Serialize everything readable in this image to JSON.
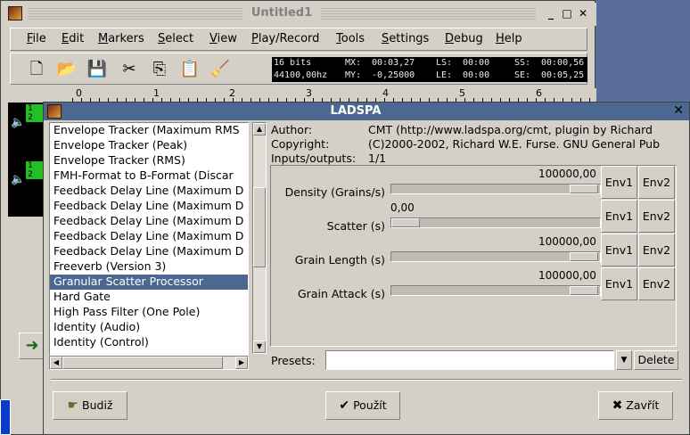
{
  "main_window": {
    "title": "Untitled1",
    "menu": [
      "File",
      "Edit",
      "Markers",
      "Select",
      "View",
      "Play/Record",
      "Tools",
      "Settings",
      "Debug",
      "Help"
    ],
    "toolbar_icons": [
      "new-file-icon",
      "open-folder-icon",
      "save-icon",
      "cut-icon",
      "copy-icon",
      "paste-icon",
      "clear-icon"
    ],
    "status": {
      "format": "16 bits",
      "rate": "44100,00hz",
      "mx_label": "MX:",
      "mx": "00:03,27",
      "my_label": "MY:",
      "my": "-0,25000",
      "ls_label": "LS:",
      "ls": "00:00",
      "le_label": "LE:",
      "le": "00:00",
      "ss_label": "SS:",
      "ss": "00:00,56",
      "se_label": "SE:",
      "se": "00:05,25"
    },
    "ruler_labels": [
      "0",
      "1",
      "2",
      "3",
      "4",
      "5",
      "6"
    ],
    "track_numbers": [
      "1",
      "2",
      "1",
      "2"
    ]
  },
  "dialog": {
    "title": "LADSPA",
    "plugins": [
      "Envelope Tracker (Maximum RMS",
      "Envelope Tracker (Peak)",
      "Envelope Tracker (RMS)",
      "FMH-Format to B-Format (Discar",
      "Feedback Delay Line (Maximum D",
      "Feedback Delay Line (Maximum D",
      "Feedback Delay Line (Maximum D",
      "Feedback Delay Line (Maximum D",
      "Feedback Delay Line (Maximum D",
      "Freeverb (Version 3)",
      "Granular Scatter Processor",
      "Hard Gate",
      "High Pass Filter (One Pole)",
      "Identity (Audio)",
      "Identity (Control)"
    ],
    "selected_plugin": "Granular Scatter Processor",
    "info": {
      "author_label": "Author:",
      "author": "CMT (http://www.ladspa.org/cmt, plugin by Richard",
      "copyright_label": "Copyright:",
      "copyright": "(C)2000-2002, Richard W.E. Furse. GNU General Pub",
      "io_label": "Inputs/outputs:",
      "io": "1/1"
    },
    "params": [
      {
        "label": "Density (Grains/s)",
        "value": "100000,00",
        "level": 1.0
      },
      {
        "label": "Scatter (s)",
        "value": "0,00",
        "level": 0.0
      },
      {
        "label": "Grain Length (s)",
        "value": "100000,00",
        "level": 1.0
      },
      {
        "label": "Grain Attack (s)",
        "value": "100000,00",
        "level": 1.0
      }
    ],
    "env1_label": "Env1",
    "env2_label": "Env2",
    "presets_label": "Presets:",
    "presets_value": "",
    "delete_label": "Delete",
    "buttons": {
      "ok": "Budiž",
      "apply": "Použít",
      "close": "Zavřít"
    }
  }
}
